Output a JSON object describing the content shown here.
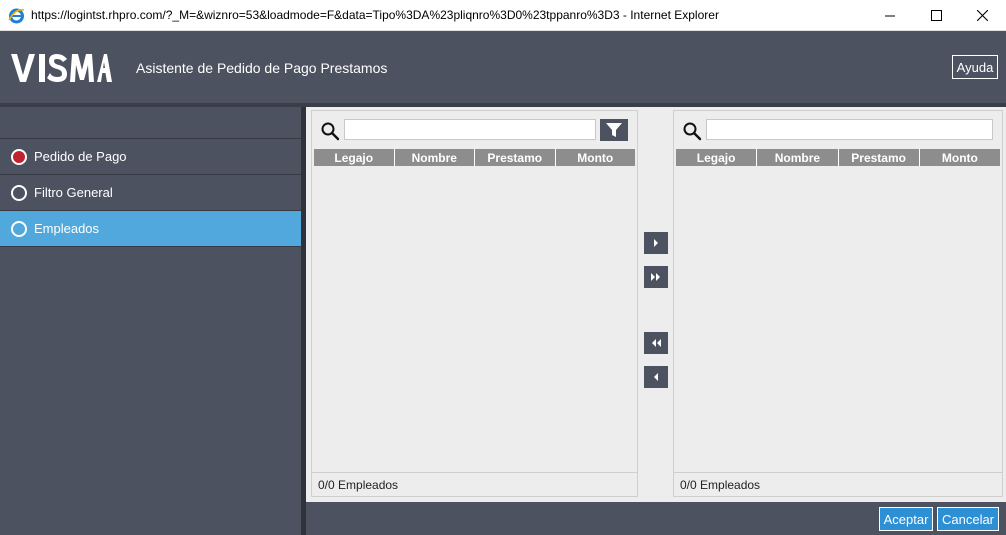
{
  "window": {
    "title": "https://logintst.rhpro.com/?_M=&wiznro=53&loadmode=F&data=Tipo%3DA%23pliqnro%3D0%23tppanro%3D3  - Internet Explorer"
  },
  "header": {
    "logo": "VISMA",
    "title": "Asistente de Pedido de Pago Prestamos",
    "help_label": "Ayuda"
  },
  "sidebar": {
    "items": [
      {
        "label": "Pedido de Pago",
        "state": "completed"
      },
      {
        "label": "Filtro General",
        "state": "pending"
      },
      {
        "label": "Empleados",
        "state": "active"
      }
    ]
  },
  "left_panel": {
    "search_value": "",
    "columns": [
      "Legajo",
      "Nombre",
      "Prestamo",
      "Monto"
    ],
    "rows": [],
    "footer": "0/0 Empleados"
  },
  "right_panel": {
    "search_value": "",
    "columns": [
      "Legajo",
      "Nombre",
      "Prestamo",
      "Monto"
    ],
    "rows": [],
    "footer": "0/0 Empleados"
  },
  "footer": {
    "accept_label": "Aceptar",
    "cancel_label": "Cancelar"
  },
  "colors": {
    "header_bg": "#4d5260",
    "active_item": "#50a8dd",
    "completed_dot": "#c0232e",
    "primary_button": "#2d8fd4",
    "grid_header": "#8d8d8d"
  }
}
